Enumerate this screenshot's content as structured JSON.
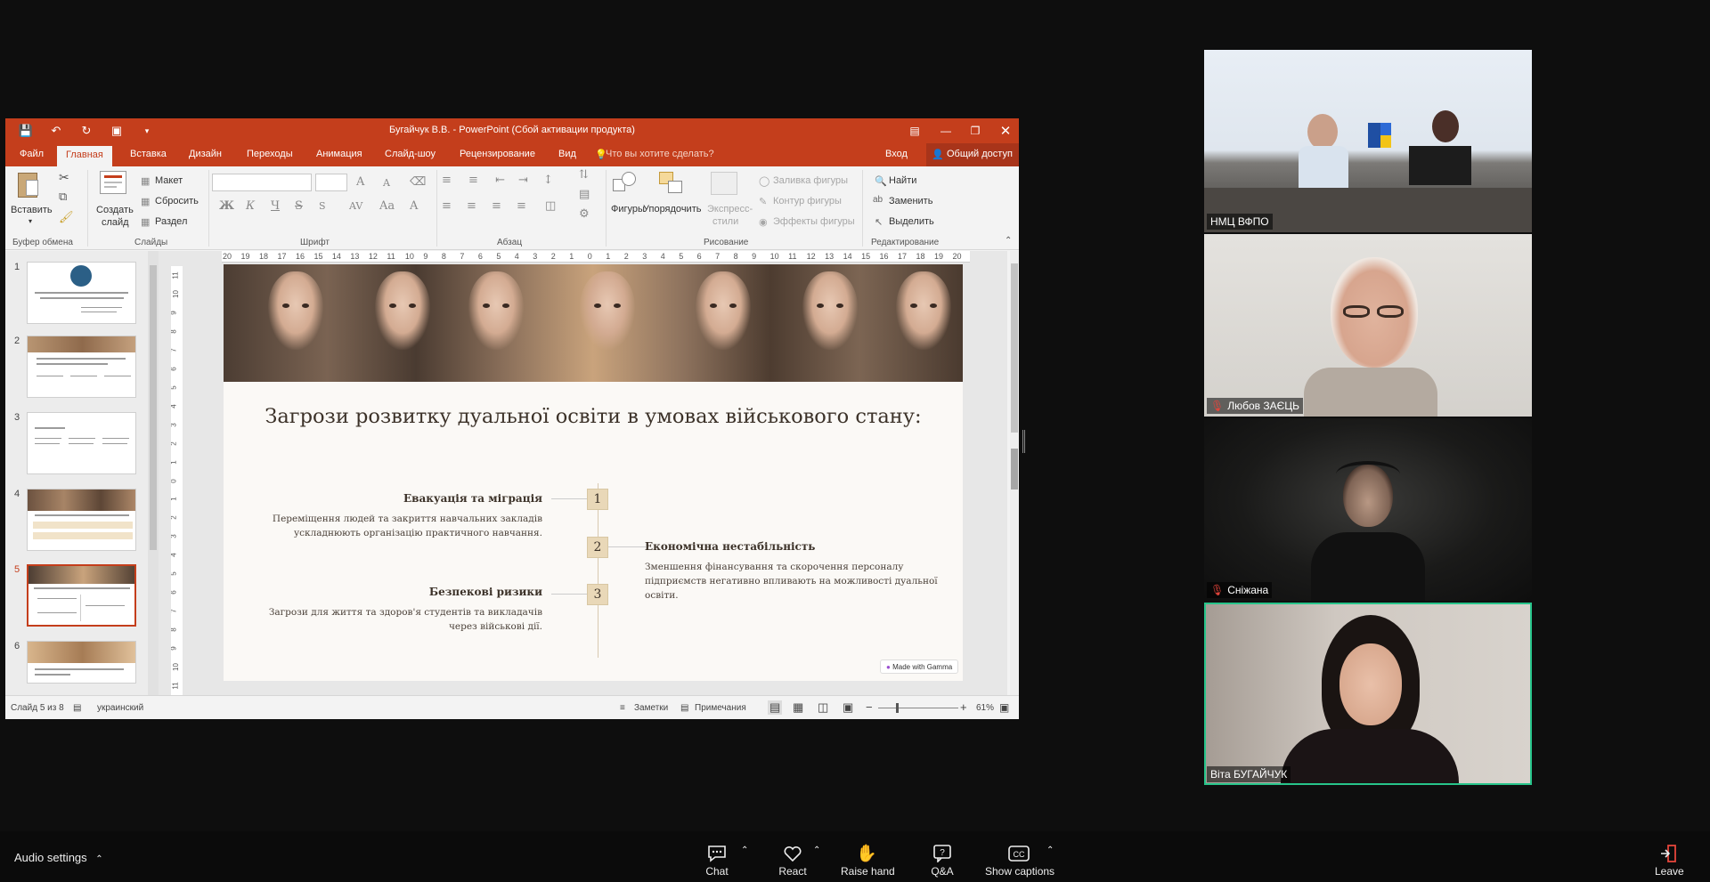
{
  "ppt": {
    "window_title": "Бугайчук В.В. - PowerPoint (Сбой активации продукта)",
    "tabs": [
      "Файл",
      "Главная",
      "Вставка",
      "Дизайн",
      "Переходы",
      "Анимация",
      "Слайд-шоу",
      "Рецензирование",
      "Вид"
    ],
    "active_tab": "Главная",
    "tell_me": "Что вы хотите сделать?",
    "signin": "Вход",
    "share": "Общий доступ",
    "ribbon": {
      "paste": "Вставить",
      "new_slide_1": "Создать",
      "new_slide_2": "слайд",
      "layout": "Макет",
      "reset": "Сбросить",
      "section": "Раздел",
      "bold": "Ж",
      "italic": "К",
      "underline": "Ч",
      "strike": "S",
      "spacing": "AV",
      "case": "Aa",
      "font_color": "A",
      "font_up": "A",
      "font_down": "A",
      "shapes": "Фигуры",
      "arrange": "Упорядочить",
      "quick_styles_1": "Экспресс-",
      "quick_styles_2": "стили",
      "shape_fill": "Заливка фигуры",
      "shape_outline": "Контур фигуры",
      "shape_effects": "Эффекты фигуры",
      "find": "Найти",
      "replace": "Заменить",
      "select": "Выделить",
      "groups": {
        "clipboard": "Буфер обмена",
        "slides": "Слайды",
        "font": "Шрифт",
        "paragraph": "Абзац",
        "drawing": "Рисование",
        "editing": "Редактирование"
      }
    },
    "thumbnails": [
      "1",
      "2",
      "3",
      "4",
      "5",
      "6"
    ],
    "selected_slide": "5",
    "ruler_h": [
      "20",
      "19",
      "18",
      "17",
      "16",
      "15",
      "14",
      "13",
      "12",
      "11",
      "10",
      "9",
      "8",
      "7",
      "6",
      "5",
      "4",
      "3",
      "2",
      "1",
      "0",
      "1",
      "2",
      "3",
      "4",
      "5",
      "6",
      "7",
      "8",
      "9",
      "10",
      "11",
      "12",
      "13",
      "14",
      "15",
      "16",
      "17",
      "18",
      "19",
      "20"
    ],
    "ruler_v": [
      "11",
      "10",
      "9",
      "8",
      "7",
      "6",
      "5",
      "4",
      "3",
      "2",
      "1",
      "0",
      "1",
      "2",
      "3",
      "4",
      "5",
      "6",
      "7",
      "8",
      "9",
      "10",
      "11"
    ],
    "slide": {
      "title": "Загрози розвитку дуальної освіти в умовах військового стану:",
      "items": [
        {
          "num": "1",
          "heading": "Евакуація та міграція",
          "text_1": "Переміщення людей та закриття навчальних закладів",
          "text_2": "ускладнюють організацію практичного навчання."
        },
        {
          "num": "2",
          "heading": "Економічна нестабільність",
          "text_1": "Зменшення фінансування та скорочення персоналу",
          "text_2": "підприємств негативно впливають на можливості дуальної",
          "text_3": "освіти."
        },
        {
          "num": "3",
          "heading": "Безпекові ризики",
          "text_1": "Загрози для життя та здоров'я студентів та викладачів",
          "text_2": "через військові дії."
        }
      ],
      "badge": "Made with Gamma"
    },
    "status": {
      "slide_of": "Слайд 5 из 8",
      "language": "украинский",
      "notes": "Заметки",
      "comments": "Примечания",
      "zoom": "61%"
    }
  },
  "participants": [
    {
      "name": "НМЦ ВФПО",
      "muted": false
    },
    {
      "name": "Любов ЗАЄЦЬ",
      "muted": true
    },
    {
      "name": "Сніжана",
      "muted": true
    },
    {
      "name": "Віта БУГАЙЧУК",
      "muted": false,
      "active_speaker": true
    }
  ],
  "bottombar": {
    "audio": "Audio settings",
    "chat": "Chat",
    "react": "React",
    "raise": "Raise hand",
    "qa": "Q&A",
    "captions": "Show captions",
    "leave": "Leave"
  },
  "colors": {
    "ppt_accent": "#c43e1c",
    "active_speaker": "#27c48a",
    "gold": "#e9d8b8"
  }
}
